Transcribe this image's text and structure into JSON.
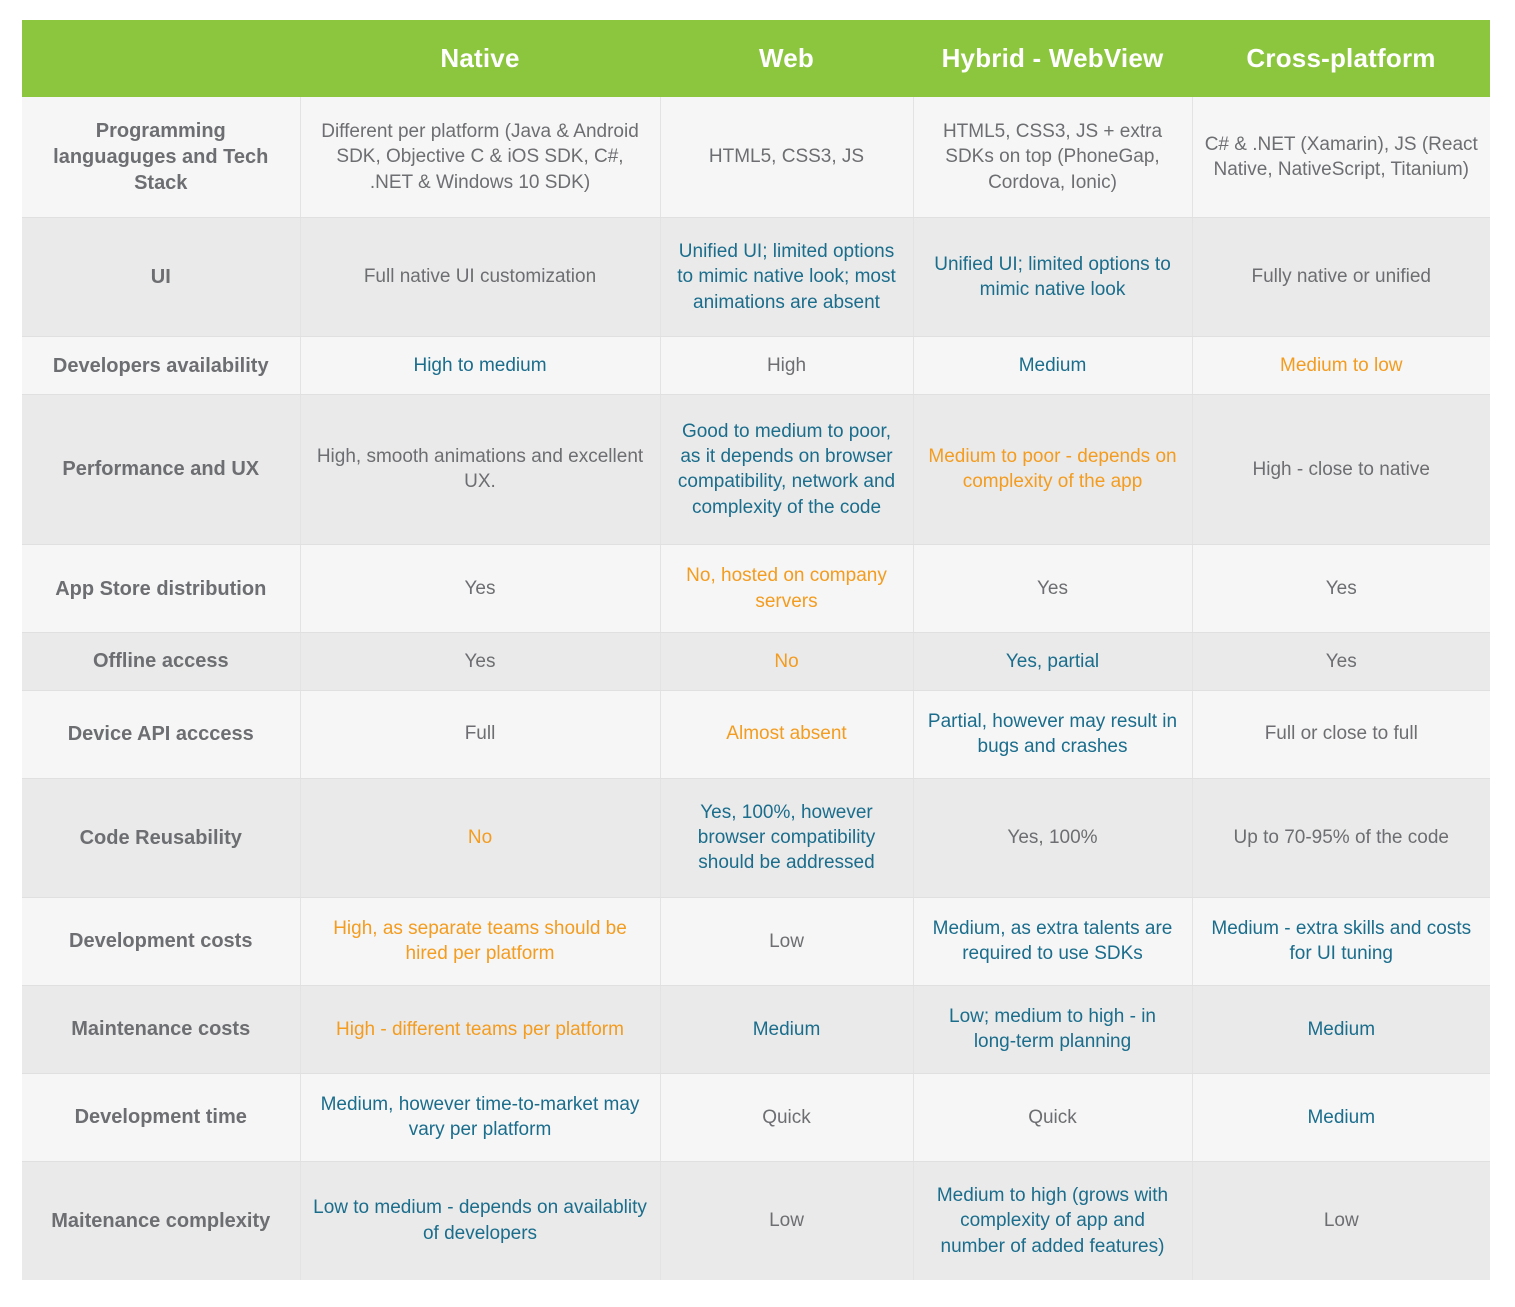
{
  "colors": {
    "header_green": "#8cc63e",
    "blue": "#1b6d8c",
    "orange": "#f39c1f",
    "gray": "#6d6e71",
    "row_light": "#f6f6f6",
    "row_dark": "#eaeaea"
  },
  "table": {
    "columns": [
      {
        "key": "label",
        "label": ""
      },
      {
        "key": "native",
        "label": "Native"
      },
      {
        "key": "web",
        "label": "Web"
      },
      {
        "key": "hybrid",
        "label": "Hybrid - WebView"
      },
      {
        "key": "cross",
        "label": "Cross-platform"
      }
    ],
    "rows": [
      {
        "label": "Programming languaguges and Tech Stack",
        "cells": [
          {
            "text": "Different per platform (Java & Android SDK, Objective C & iOS SDK, C#, .NET & Windows 10 SDK)",
            "tone": "gray"
          },
          {
            "text": "HTML5, CSS3, JS",
            "tone": "gray"
          },
          {
            "text": "HTML5, CSS3, JS + extra SDKs on top (PhoneGap, Cordova, Ionic)",
            "tone": "gray"
          },
          {
            "text": "C# & .NET (Xamarin), JS (React Native, NativeScript, Titanium)",
            "tone": "gray"
          }
        ]
      },
      {
        "label": "UI",
        "cells": [
          {
            "text": "Full native UI customization",
            "tone": "gray"
          },
          {
            "text": "Unified UI; limited options to mimic native look; most animations are absent",
            "tone": "blue"
          },
          {
            "text": "Unified UI; limited options to mimic native look",
            "tone": "blue"
          },
          {
            "text": "Fully native or unified",
            "tone": "gray"
          }
        ]
      },
      {
        "label": "Developers availability",
        "cells": [
          {
            "text": "High to medium",
            "tone": "blue"
          },
          {
            "text": "High",
            "tone": "gray"
          },
          {
            "text": "Medium",
            "tone": "blue"
          },
          {
            "text": "Medium to low",
            "tone": "orange"
          }
        ]
      },
      {
        "label": "Performance and UX",
        "cells": [
          {
            "text": "High, smooth animations and excellent UX.",
            "tone": "gray"
          },
          {
            "text": "Good to medium to poor, as it depends on browser compatibility, network and complexity of the code",
            "tone": "blue"
          },
          {
            "text": "Medium to poor - depends on complexity of the app",
            "tone": "orange"
          },
          {
            "text": "High - close to native",
            "tone": "gray"
          }
        ]
      },
      {
        "label": "App Store distribution",
        "cells": [
          {
            "text": "Yes",
            "tone": "gray"
          },
          {
            "text": "No, hosted on company servers",
            "tone": "orange"
          },
          {
            "text": "Yes",
            "tone": "gray"
          },
          {
            "text": "Yes",
            "tone": "gray"
          }
        ]
      },
      {
        "label": "Offline access",
        "cells": [
          {
            "text": "Yes",
            "tone": "gray"
          },
          {
            "text": "No",
            "tone": "orange"
          },
          {
            "text": "Yes, partial",
            "tone": "blue"
          },
          {
            "text": "Yes",
            "tone": "gray"
          }
        ]
      },
      {
        "label": "Device API acccess",
        "cells": [
          {
            "text": "Full",
            "tone": "gray"
          },
          {
            "text": "Almost absent",
            "tone": "orange"
          },
          {
            "text": "Partial, however may result in bugs and crashes",
            "tone": "blue"
          },
          {
            "text": "Full or close to full",
            "tone": "gray"
          }
        ]
      },
      {
        "label": "Code Reusability",
        "cells": [
          {
            "text": "No",
            "tone": "orange"
          },
          {
            "text": "Yes, 100%, however browser compatibility should be addressed",
            "tone": "blue"
          },
          {
            "text": "Yes, 100%",
            "tone": "gray"
          },
          {
            "text": "Up to 70-95% of the code",
            "tone": "gray"
          }
        ]
      },
      {
        "label": "Development costs",
        "cells": [
          {
            "text": "High, as separate teams should be hired per platform",
            "tone": "orange"
          },
          {
            "text": "Low",
            "tone": "gray"
          },
          {
            "text": "Medium, as extra talents are required to use SDKs",
            "tone": "blue"
          },
          {
            "text": "Medium - extra skills and costs for UI tuning",
            "tone": "blue"
          }
        ]
      },
      {
        "label": "Maintenance costs",
        "cells": [
          {
            "text": "High  - different teams per platform",
            "tone": "orange"
          },
          {
            "text": "Medium",
            "tone": "blue"
          },
          {
            "text": "Low; medium to high - in long-term planning",
            "tone": "blue"
          },
          {
            "text": "Medium",
            "tone": "blue"
          }
        ]
      },
      {
        "label": "Development time",
        "cells": [
          {
            "text": "Medium, however time-to-market may vary per platform",
            "tone": "blue"
          },
          {
            "text": "Quick",
            "tone": "gray"
          },
          {
            "text": "Quick",
            "tone": "gray"
          },
          {
            "text": "Medium",
            "tone": "blue"
          }
        ]
      },
      {
        "label": "Maitenance complexity",
        "cells": [
          {
            "text": "Low to medium - depends on availablity of developers",
            "tone": "blue"
          },
          {
            "text": "Low",
            "tone": "gray"
          },
          {
            "text": "Medium to high (grows with complexity of app and number of added features)",
            "tone": "blue"
          },
          {
            "text": "Low",
            "tone": "gray"
          }
        ]
      }
    ]
  }
}
